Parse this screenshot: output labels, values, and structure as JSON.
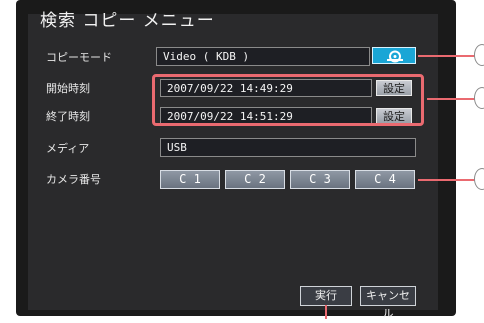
{
  "menu_title": "検索 コピー メニュー",
  "rows": {
    "copy_mode": {
      "label": "コピーモード",
      "value": "Video  ( KDB )"
    },
    "start_time": {
      "label": "開始時刻",
      "value": "2007/09/22  14:49:29",
      "button": "設定"
    },
    "end_time": {
      "label": "終了時刻",
      "value": "2007/09/22  14:51:29",
      "button": "設定"
    },
    "media": {
      "label": "メディア",
      "value": "USB"
    },
    "camera": {
      "label": "カメラ番号",
      "buttons": [
        "C 1",
        "C 2",
        "C 3",
        "C 4"
      ]
    }
  },
  "actions": {
    "execute": "実行",
    "cancel": "キャンセル"
  },
  "colors": {
    "highlight": "#ea6a70",
    "icon_button": "#1aa6d6"
  },
  "icons": {
    "copy_mode_button": "disc-icon"
  }
}
